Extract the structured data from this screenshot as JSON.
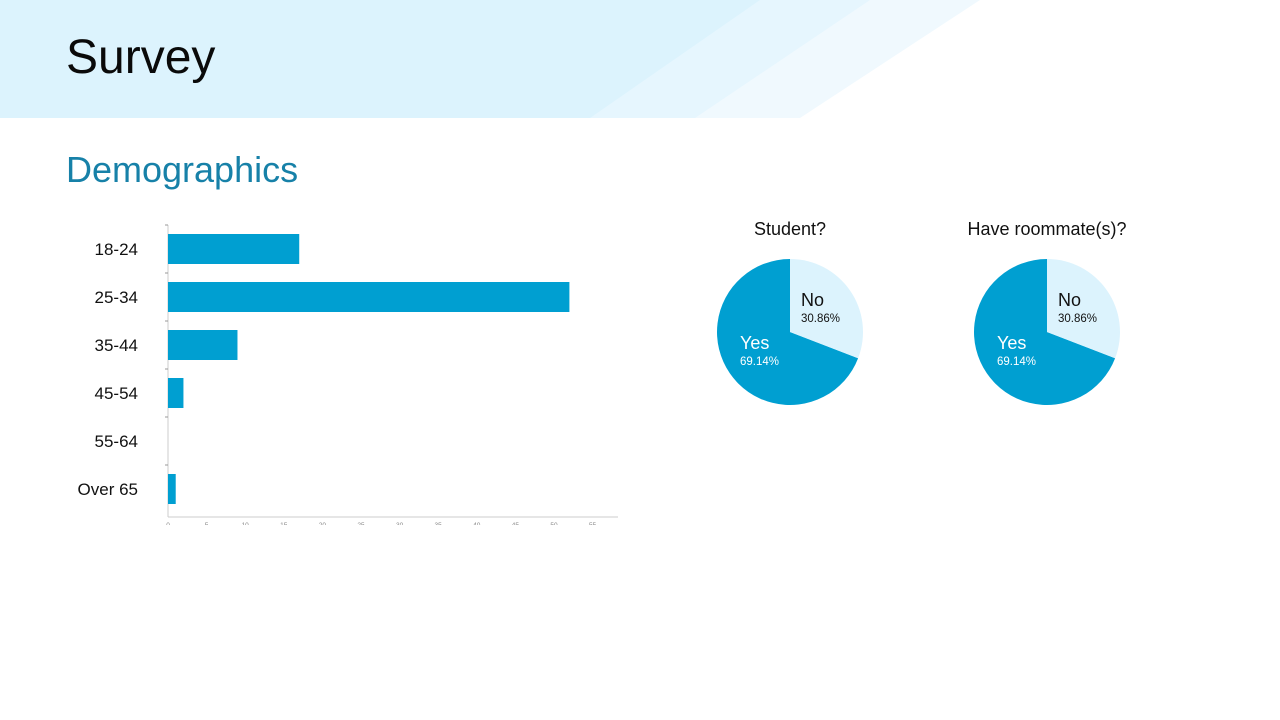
{
  "header": {
    "title": "Survey"
  },
  "section": {
    "title": "Demographics"
  },
  "colors": {
    "accent": "#009fd1",
    "light": "#dcf3fd",
    "header_band": "#dcf3fd",
    "section_title": "#1781a8"
  },
  "chart_data": [
    {
      "type": "bar",
      "orientation": "horizontal",
      "categories": [
        "18-24",
        "25-34",
        "35-44",
        "45-54",
        "55-64",
        "Over 65"
      ],
      "values": [
        17,
        52,
        9,
        2,
        0,
        1
      ],
      "xlim": [
        0,
        57
      ],
      "xticks": [
        0,
        5,
        10,
        15,
        20,
        25,
        30,
        35,
        40,
        45,
        50,
        55
      ],
      "grid": false
    },
    {
      "type": "pie",
      "title": "Student?",
      "slices": [
        {
          "label": "Yes",
          "value": 69.14,
          "pct_label": "69.14%"
        },
        {
          "label": "No",
          "value": 30.86,
          "pct_label": "30.86%"
        }
      ]
    },
    {
      "type": "pie",
      "title": "Have roommate(s)?",
      "slices": [
        {
          "label": "Yes",
          "value": 69.14,
          "pct_label": "69.14%"
        },
        {
          "label": "No",
          "value": 30.86,
          "pct_label": "30.86%"
        }
      ]
    }
  ]
}
